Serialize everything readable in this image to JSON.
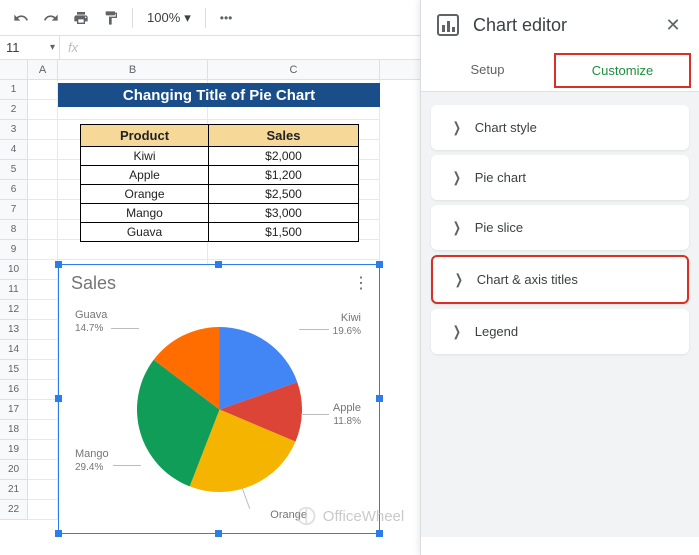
{
  "toolbar": {
    "zoom": "100%"
  },
  "namebox": "11",
  "columns": [
    "A",
    "B",
    "C"
  ],
  "rows": [
    "1",
    "2",
    "3",
    "4",
    "5",
    "6",
    "7",
    "8",
    "9",
    "10",
    "11",
    "12",
    "13",
    "14",
    "15",
    "16",
    "17",
    "18",
    "19",
    "20",
    "21",
    "22"
  ],
  "banner": "Changing Title of Pie Chart",
  "table": {
    "headers": [
      "Product",
      "Sales"
    ],
    "rows": [
      [
        "Kiwi",
        "$2,000"
      ],
      [
        "Apple",
        "$1,200"
      ],
      [
        "Orange",
        "$2,500"
      ],
      [
        "Mango",
        "$3,000"
      ],
      [
        "Guava",
        "$1,500"
      ]
    ]
  },
  "chart_data": {
    "type": "pie",
    "title": "Sales",
    "series": [
      {
        "name": "Kiwi",
        "value": 2000,
        "pct": "19.6%",
        "color": "#4285F4"
      },
      {
        "name": "Apple",
        "value": 1200,
        "pct": "11.8%",
        "color": "#DB4437"
      },
      {
        "name": "Orange",
        "value": 2500,
        "pct": "24.5%",
        "color": "#F4B400"
      },
      {
        "name": "Mango",
        "value": 3000,
        "pct": "29.4%",
        "color": "#0F9D58"
      },
      {
        "name": "Guava",
        "value": 1500,
        "pct": "14.7%",
        "color": "#FF6D00"
      }
    ]
  },
  "editor": {
    "title": "Chart editor",
    "tabs": {
      "setup": "Setup",
      "customize": "Customize"
    },
    "sections": [
      "Chart style",
      "Pie chart",
      "Pie slice",
      "Chart & axis titles",
      "Legend"
    ]
  },
  "watermark": "OfficeWheel"
}
